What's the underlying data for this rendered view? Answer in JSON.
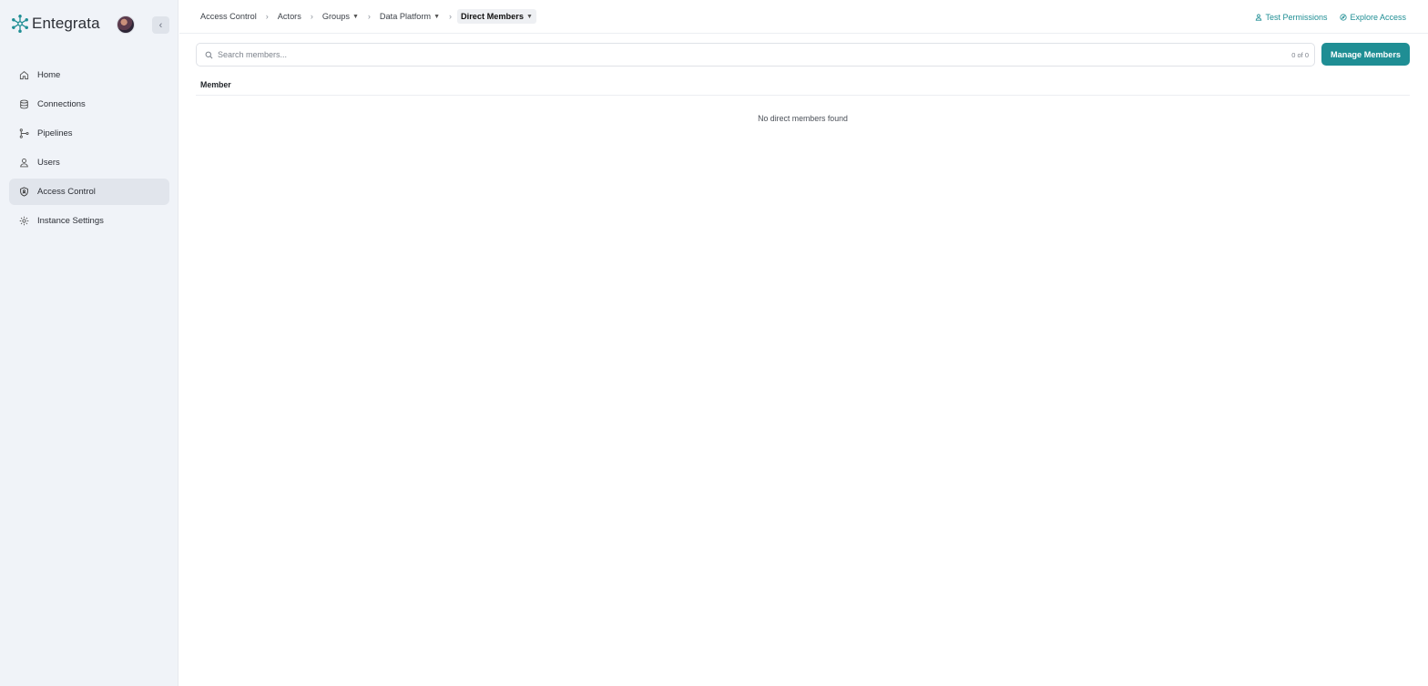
{
  "brand": {
    "name": "Entegrata",
    "accent": "#1f8e94"
  },
  "sidebar": {
    "collapse_icon": "chevron-left-icon",
    "items": [
      {
        "label": "Home",
        "icon": "home-icon",
        "active": false
      },
      {
        "label": "Connections",
        "icon": "database-icon",
        "active": false
      },
      {
        "label": "Pipelines",
        "icon": "pipeline-icon",
        "active": false
      },
      {
        "label": "Users",
        "icon": "user-icon",
        "active": false
      },
      {
        "label": "Access Control",
        "icon": "shield-icon",
        "active": true
      },
      {
        "label": "Instance Settings",
        "icon": "gear-icon",
        "active": false
      }
    ]
  },
  "header": {
    "breadcrumb": [
      {
        "label": "Access Control",
        "dropdown": false
      },
      {
        "label": "Actors",
        "dropdown": false
      },
      {
        "label": "Groups",
        "dropdown": true
      },
      {
        "label": "Data Platform",
        "dropdown": true
      },
      {
        "label": "Direct Members",
        "dropdown": true,
        "current": true
      }
    ],
    "actions": {
      "test_permissions": "Test Permissions",
      "explore_access": "Explore Access"
    }
  },
  "main": {
    "search": {
      "placeholder": "Search members...",
      "value": "",
      "count": "0 of 0"
    },
    "manage_button": "Manage Members",
    "table": {
      "columns": [
        "Member"
      ],
      "empty_message": "No direct members found"
    }
  }
}
